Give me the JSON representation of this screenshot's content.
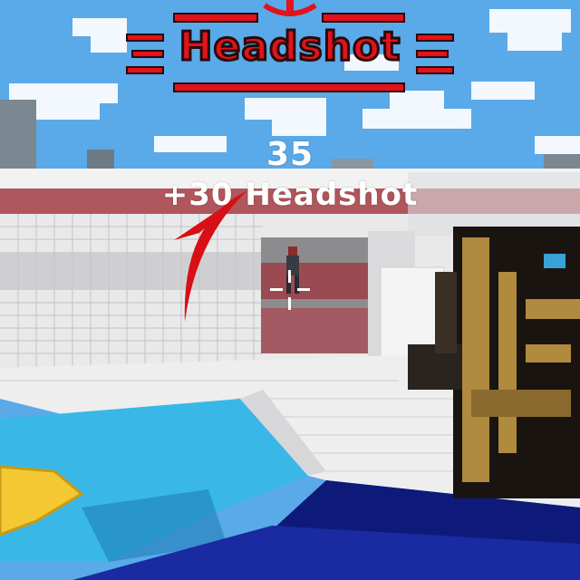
{
  "hud": {
    "banner_label": "Headshot",
    "score": "35",
    "bonus_text": "+30 Headshot"
  },
  "icons": {
    "crosshair": "crosshair-icon",
    "hit_direction": "hit-direction-indicator-icon",
    "headshot_emblem": "headshot-emblem-icon"
  },
  "colors": {
    "banner_red": "#e3121b",
    "banner_outline": "#2a0a0a",
    "sky": "#5aa9e8",
    "water": "#39b8e8",
    "tile": "#f2f2f2",
    "stripe": "#b0565d",
    "weapon_gold": "#b08a3e"
  }
}
